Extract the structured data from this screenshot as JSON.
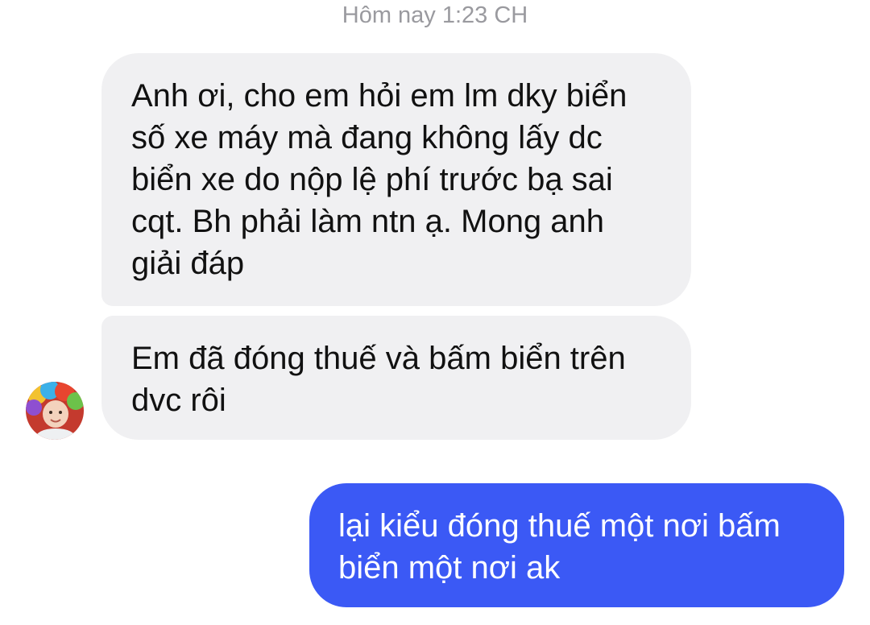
{
  "thread": {
    "timestamp": "Hôm nay 1:23 CH",
    "messages": [
      {
        "sender": "them",
        "text": "Anh ơi, cho em hỏi em lm dky biển\nsố xe máy mà đang không lấy dc\nbiển xe do nộp lệ phí trước bạ sai\ncqt. Bh phải làm ntn ạ. Mong anh\ngiải đáp"
      },
      {
        "sender": "them",
        "text": "Em đã đóng thuế và bấm biển trên\ndvc rôi"
      },
      {
        "sender": "me",
        "text": "lại kiểu đóng thuế một nơi bấm\nbiển một nơi ak"
      }
    ]
  },
  "colors": {
    "incoming_bubble": "#f0f0f2",
    "outgoing_bubble": "#3b59f5",
    "timestamp_text": "#9a9a9f"
  },
  "icons": {
    "avatar": "contact-avatar-photo"
  }
}
